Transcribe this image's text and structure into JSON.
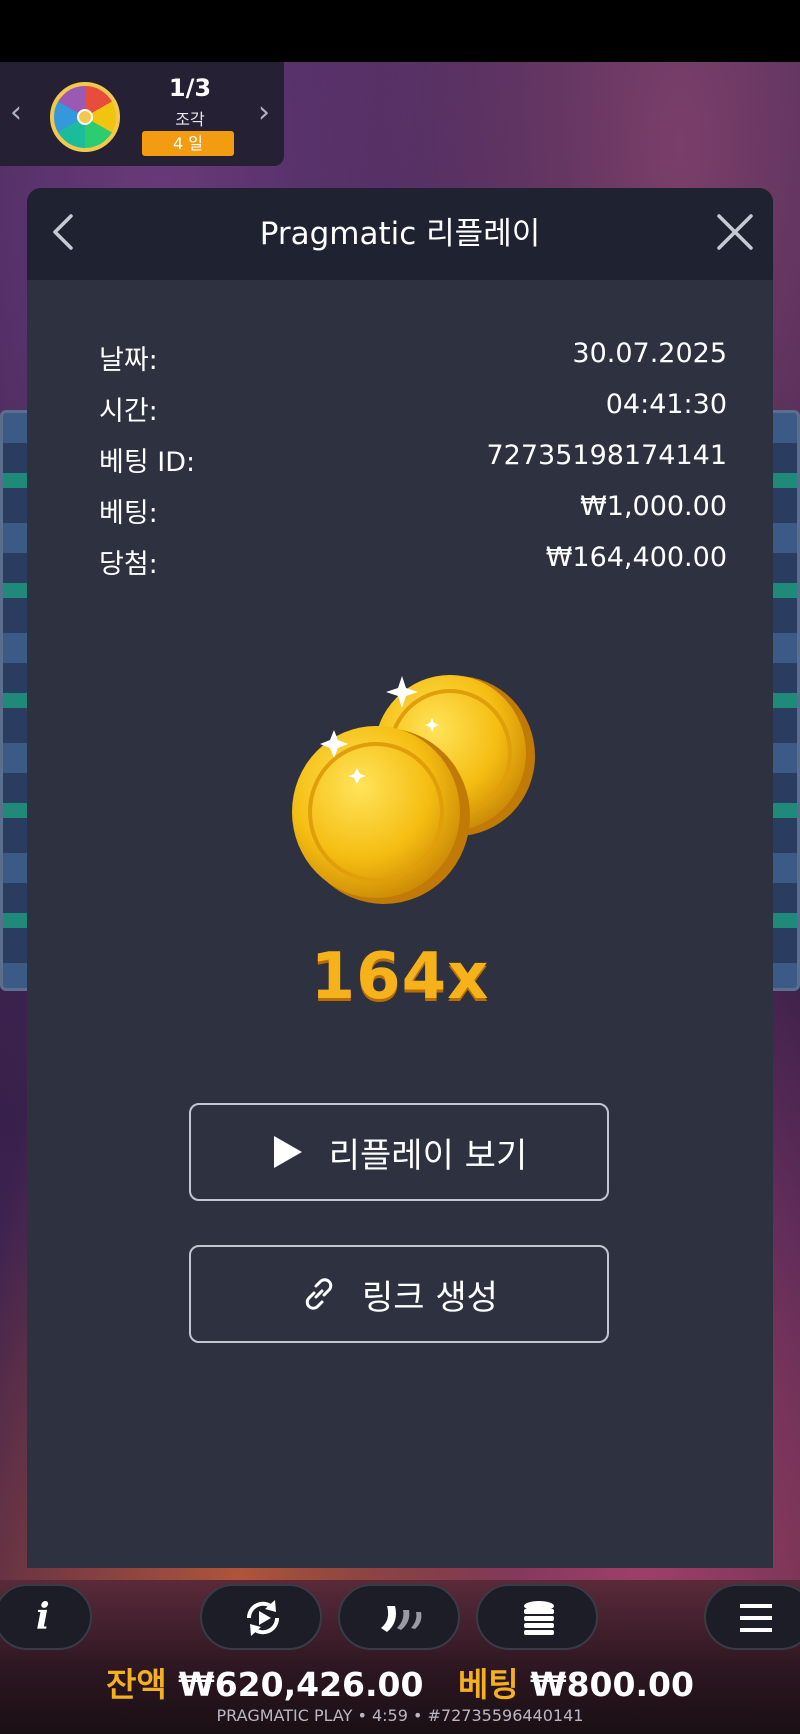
{
  "widget": {
    "count": "1/3",
    "sub_label": "조각",
    "badge": "4 일"
  },
  "modal": {
    "title": "Pragmatic 리플레이",
    "info": [
      {
        "label": "날짜:",
        "value": "30.07.2025"
      },
      {
        "label": "시간:",
        "value": "04:41:30"
      },
      {
        "label": "베팅 ID:",
        "value": "72735198174141"
      },
      {
        "label": "베팅:",
        "value": "₩1,000.00"
      },
      {
        "label": "당첨:",
        "value": "₩164,400.00"
      }
    ],
    "multiplier": "164x",
    "replay_button": "리플레이 보기",
    "link_button": "링크 생성"
  },
  "footer": {
    "balance_label": "잔액",
    "balance_value": "₩620,426.00",
    "bet_label": "베팅",
    "bet_value": "₩800.00",
    "info_line": "PRAGMATIC PLAY • 4:59 • #72735596440141"
  },
  "colors": {
    "accent": "#f6b21b",
    "modal_bg": "#2e3140",
    "header_bg": "#1f2230"
  }
}
